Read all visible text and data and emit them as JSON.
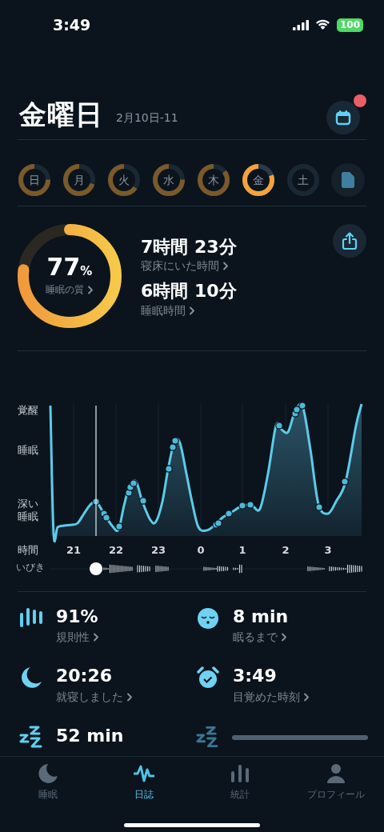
{
  "status_bar": {
    "time": "3:49",
    "battery": "100"
  },
  "header": {
    "title": "金曜日",
    "date": "2月10日-11",
    "calendar_badge": true
  },
  "days": [
    {
      "label": "日",
      "recorded": true,
      "selected": false
    },
    {
      "label": "月",
      "recorded": true,
      "selected": false
    },
    {
      "label": "火",
      "recorded": true,
      "selected": false
    },
    {
      "label": "水",
      "recorded": true,
      "selected": false
    },
    {
      "label": "木",
      "recorded": true,
      "selected": false
    },
    {
      "label": "金",
      "recorded": true,
      "selected": true
    },
    {
      "label": "土",
      "recorded": false,
      "selected": false
    }
  ],
  "summary": {
    "quality": {
      "value": "77",
      "unit": "%",
      "label": "睡眠の質"
    },
    "metrics": [
      {
        "value": "7時間 23分",
        "label": "寝床にいた時間"
      },
      {
        "value": "6時間 10分",
        "label": "睡眠時間"
      }
    ]
  },
  "sleep_graph": {
    "y_labels": [
      "覚醒",
      "睡眠",
      "深い睡眠"
    ],
    "x_title": "時間",
    "hours": [
      "21",
      "22",
      "23",
      "0",
      "1",
      "2",
      "3"
    ],
    "snore_label": "いびき"
  },
  "stats": [
    {
      "kind": "regularity",
      "value": "91%",
      "label": "規則性"
    },
    {
      "kind": "fall_asleep",
      "value": "8 min",
      "label": "眠るまで"
    },
    {
      "kind": "bedtime",
      "value": "20:26",
      "label": "就寝しました"
    },
    {
      "kind": "wake",
      "value": "3:49",
      "label": "目覚めた時刻"
    },
    {
      "kind": "snore",
      "value": "52 min"
    },
    {
      "kind": "loading"
    }
  ],
  "tabs": [
    {
      "label": "睡眠",
      "selected": false
    },
    {
      "label": "日誌",
      "selected": true
    },
    {
      "label": "統計",
      "selected": false
    },
    {
      "label": "プロフィール",
      "selected": false
    }
  ]
}
